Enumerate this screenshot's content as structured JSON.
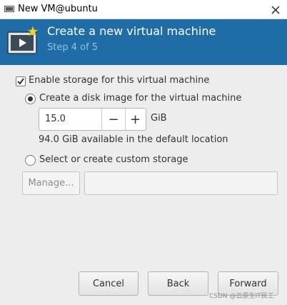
{
  "window": {
    "title": "New VM@ubuntu",
    "close_icon": "close-icon"
  },
  "banner": {
    "heading": "Create a new virtual machine",
    "step": "Step 4 of 5",
    "background": "#1f6ca6"
  },
  "storage": {
    "enable_label": "Enable storage for this virtual machine",
    "enable_checked": true,
    "disk_image_label": "Create a disk image for the virtual machine",
    "disk_image_selected": true,
    "size_value": "15.0",
    "minus_label": "−",
    "plus_label": "+",
    "unit": "GiB",
    "available_text": "94.0 GiB available in the default location",
    "custom_label": "Select or create custom storage",
    "custom_selected": false,
    "manage_label": "Manage...",
    "path_value": ""
  },
  "footer": {
    "cancel_label": "Cancel",
    "back_label": "Back",
    "forward_label": "Forward"
  },
  "watermark": "CSDN @云原生IT民工"
}
